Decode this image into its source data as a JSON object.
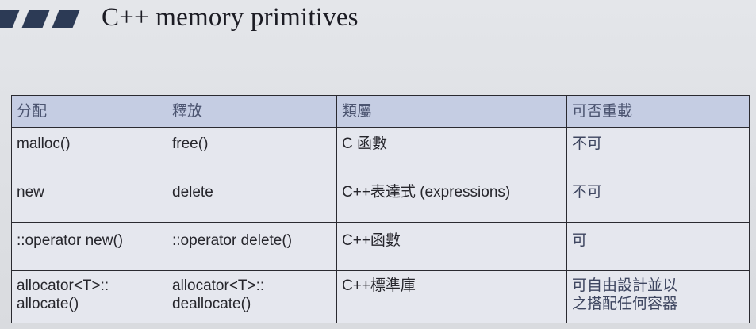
{
  "slide": {
    "title": "C++ memory primitives"
  },
  "table": {
    "headers": [
      "分配",
      "釋放",
      "類屬",
      "可否重載"
    ],
    "rows": [
      {
        "alloc": [
          "malloc()"
        ],
        "release": [
          "free()"
        ],
        "category": "C 函數",
        "overload": [
          "不可"
        ]
      },
      {
        "alloc": [
          "new"
        ],
        "release": [
          "delete"
        ],
        "category": "C++表達式 (expressions)",
        "overload": [
          "不可"
        ]
      },
      {
        "alloc": [
          "::operator new()"
        ],
        "release": [
          "::operator delete()"
        ],
        "category": "C++函數",
        "overload": [
          "可"
        ]
      },
      {
        "alloc": [
          "allocator<T>::",
          "allocate()"
        ],
        "release": [
          "allocator<T>::",
          "deallocate()"
        ],
        "category": "C++標準庫",
        "overload": [
          "可自由設計並以",
          "之搭配任何容器"
        ]
      }
    ]
  },
  "colors": {
    "header_bg": "#c5cde3",
    "header_text": "#4b5470",
    "accent_bars": "#2c3a55",
    "border": "#2a2a30"
  }
}
